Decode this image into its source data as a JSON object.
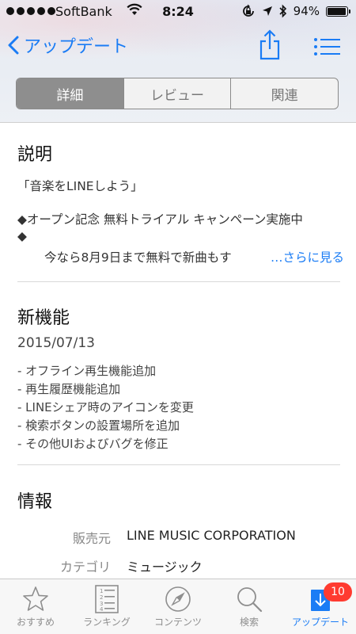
{
  "status": {
    "carrier": "SoftBank",
    "time": "8:24",
    "battery": "94%",
    "battery_level": 0.94
  },
  "nav": {
    "back_label": "アップデート"
  },
  "segments": [
    {
      "label": "詳細"
    },
    {
      "label": "レビュー"
    },
    {
      "label": "関連"
    }
  ],
  "description": {
    "title": "説明",
    "line1": "「音楽をLINEしよう」",
    "line2": "◆オープン記念 無料トライアル キャンペーン実施中",
    "line3": "◆",
    "line4": "今なら8月9日まで無料で新曲もす",
    "more": "…さらに見る"
  },
  "whats_new": {
    "title": "新機能",
    "date": "2015/07/13",
    "items": [
      "- オフライン再生機能追加",
      "- 再生履歴機能追加",
      "- LINEシェア時のアイコンを変更",
      "- 検索ボタンの設置場所を追加",
      "- その他UIおよびバグを修正"
    ]
  },
  "info": {
    "title": "情報",
    "rows": [
      {
        "label": "販売元",
        "value": "LINE MUSIC CORPORATION"
      },
      {
        "label": "カテゴリ",
        "value": "ミュージック"
      }
    ]
  },
  "tabs": [
    {
      "label": "おすすめ"
    },
    {
      "label": "ランキング"
    },
    {
      "label": "コンテンツ"
    },
    {
      "label": "検索"
    },
    {
      "label": "アップデート",
      "badge": "10"
    }
  ],
  "colors": {
    "accent": "#1a7cf5",
    "badge": "#ff3b30"
  }
}
